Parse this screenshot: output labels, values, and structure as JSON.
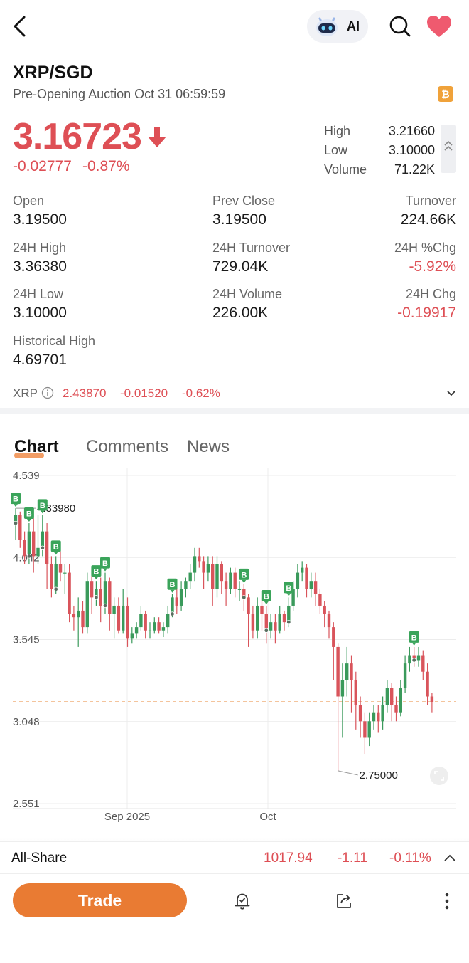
{
  "header": {
    "ai_label": "AI"
  },
  "instrument": {
    "symbol": "XRP/SGD",
    "session": "Pre-Opening Auction Oct 31 06:59:59",
    "coin_badge": "₿",
    "price": "3.16723",
    "change_abs": "-0.02777",
    "change_pct": "-0.87%",
    "direction": "down"
  },
  "summary": {
    "high_label": "High",
    "high_value": "3.21660",
    "low_label": "Low",
    "low_value": "3.10000",
    "volume_label": "Volume",
    "volume_value": "71.22K"
  },
  "stats": [
    {
      "label": "Open",
      "value": "3.19500",
      "neg": false
    },
    {
      "label": "Prev Close",
      "value": "3.19500",
      "neg": false
    },
    {
      "label": "Turnover",
      "value": "224.66K",
      "neg": false
    },
    {
      "label": "24H High",
      "value": "3.36380",
      "neg": false
    },
    {
      "label": "24H Turnover",
      "value": "729.04K",
      "neg": false
    },
    {
      "label": "24H %Chg",
      "value": "-5.92%",
      "neg": true
    },
    {
      "label": "24H Low",
      "value": "3.10000",
      "neg": false
    },
    {
      "label": "24H Volume",
      "value": "226.00K",
      "neg": false
    },
    {
      "label": "24H Chg",
      "value": "-0.19917",
      "neg": true
    },
    {
      "label": "Historical High",
      "value": "4.69701",
      "neg": false
    }
  ],
  "reference": {
    "name": "XRP",
    "price": "2.43870",
    "change": "-0.01520",
    "pct": "-0.62%"
  },
  "tabs": [
    {
      "label": "Chart",
      "active": true
    },
    {
      "label": "Comments",
      "active": false
    },
    {
      "label": "News",
      "active": false
    }
  ],
  "chart_data": {
    "type": "candlestick",
    "y_ticks": [
      "4.539",
      "4.042",
      "3.545",
      "3.048",
      "2.551"
    ],
    "ylim": [
      2.551,
      4.539
    ],
    "x_ticks": [
      "Sep 2025",
      "Oct"
    ],
    "max_label": "4.33980",
    "min_label": "2.75000",
    "last_price_line": 3.167,
    "colors": {
      "up": "#3a9a5b",
      "down": "#d9545b",
      "marker": "#3aa45a",
      "last_line": "#e8893a"
    },
    "candles": [
      [
        4.25,
        4.3,
        4.34,
        4.15
      ],
      [
        4.3,
        4.15,
        4.32,
        4.1
      ],
      [
        4.15,
        4.05,
        4.2,
        4.0
      ],
      [
        4.05,
        4.2,
        4.25,
        4.0
      ],
      [
        4.2,
        4.05,
        4.28,
        3.95
      ],
      [
        4.05,
        4.1,
        4.3,
        4.0
      ],
      [
        4.1,
        4.2,
        4.3,
        4.05
      ],
      [
        4.2,
        4.0,
        4.25,
        3.85
      ],
      [
        4.0,
        3.85,
        4.05,
        3.8
      ],
      [
        3.85,
        4.0,
        4.05,
        3.82
      ],
      [
        4.0,
        3.95,
        4.08,
        3.9
      ],
      [
        3.95,
        3.95,
        4.0,
        3.82
      ],
      [
        3.95,
        3.7,
        4.0,
        3.65
      ],
      [
        3.7,
        3.68,
        3.75,
        3.6
      ],
      [
        3.68,
        3.72,
        3.8,
        3.5
      ],
      [
        3.72,
        3.62,
        3.78,
        3.58
      ],
      [
        3.62,
        3.9,
        3.95,
        3.58
      ],
      [
        3.9,
        3.8,
        3.95,
        3.7
      ],
      [
        3.8,
        3.85,
        3.9,
        3.75
      ],
      [
        3.85,
        3.75,
        3.92,
        3.65
      ],
      [
        3.75,
        3.9,
        3.95,
        3.7
      ],
      [
        3.9,
        3.7,
        3.92,
        3.6
      ],
      [
        3.7,
        3.75,
        3.8,
        3.55
      ],
      [
        3.75,
        3.6,
        3.8,
        3.58
      ],
      [
        3.6,
        3.75,
        3.85,
        3.58
      ],
      [
        3.75,
        3.55,
        3.8,
        3.5
      ],
      [
        3.55,
        3.58,
        3.62,
        3.52
      ],
      [
        3.58,
        3.62,
        3.65,
        3.55
      ],
      [
        3.62,
        3.7,
        3.75,
        3.6
      ],
      [
        3.7,
        3.6,
        3.72,
        3.55
      ],
      [
        3.6,
        3.6,
        3.65,
        3.55
      ],
      [
        3.6,
        3.65,
        3.68,
        3.58
      ],
      [
        3.65,
        3.6,
        3.68,
        3.58
      ],
      [
        3.6,
        3.62,
        3.65,
        3.56
      ],
      [
        3.62,
        3.7,
        3.75,
        3.58
      ],
      [
        3.7,
        3.8,
        3.82,
        3.68
      ],
      [
        3.8,
        3.75,
        3.85,
        3.7
      ],
      [
        3.75,
        3.85,
        3.9,
        3.72
      ],
      [
        3.85,
        3.9,
        3.92,
        3.8
      ],
      [
        3.9,
        3.95,
        4.0,
        3.85
      ],
      [
        3.95,
        4.05,
        4.1,
        3.9
      ],
      [
        4.05,
        4.02,
        4.1,
        3.98
      ],
      [
        4.02,
        3.95,
        4.05,
        3.85
      ],
      [
        3.95,
        4.0,
        4.05,
        3.9
      ],
      [
        4.0,
        3.85,
        4.05,
        3.75
      ],
      [
        3.85,
        4.0,
        4.05,
        3.8
      ],
      [
        4.0,
        3.9,
        4.02,
        3.82
      ],
      [
        3.9,
        3.85,
        3.95,
        3.75
      ],
      [
        3.85,
        3.95,
        3.98,
        3.82
      ],
      [
        3.95,
        3.85,
        3.98,
        3.8
      ],
      [
        3.85,
        3.85,
        3.9,
        3.78
      ],
      [
        3.85,
        3.8,
        3.88,
        3.72
      ],
      [
        3.8,
        3.7,
        3.82,
        3.5
      ],
      [
        3.7,
        3.6,
        3.75,
        3.55
      ],
      [
        3.6,
        3.75,
        3.8,
        3.55
      ],
      [
        3.75,
        3.7,
        3.8,
        3.6
      ],
      [
        3.7,
        3.6,
        3.75,
        3.52
      ],
      [
        3.6,
        3.65,
        3.7,
        3.55
      ],
      [
        3.65,
        3.6,
        3.7,
        3.52
      ],
      [
        3.6,
        3.7,
        3.75,
        3.58
      ],
      [
        3.7,
        3.65,
        3.72,
        3.6
      ],
      [
        3.65,
        3.75,
        3.8,
        3.62
      ],
      [
        3.75,
        3.85,
        3.9,
        3.72
      ],
      [
        3.85,
        3.95,
        4.0,
        3.8
      ],
      [
        3.95,
        3.98,
        4.02,
        3.9
      ],
      [
        3.98,
        3.85,
        4.0,
        3.8
      ],
      [
        3.85,
        3.9,
        3.95,
        3.8
      ],
      [
        3.9,
        3.82,
        3.95,
        3.75
      ],
      [
        3.82,
        3.75,
        3.85,
        3.7
      ],
      [
        3.75,
        3.7,
        3.78,
        3.62
      ],
      [
        3.7,
        3.62,
        3.72,
        3.55
      ],
      [
        3.62,
        3.5,
        3.65,
        3.3
      ],
      [
        3.5,
        3.2,
        3.52,
        2.75
      ],
      [
        3.2,
        3.3,
        3.4,
        2.95
      ],
      [
        3.3,
        3.4,
        3.5,
        3.2
      ],
      [
        3.4,
        3.3,
        3.45,
        3.1
      ],
      [
        3.3,
        3.15,
        3.35,
        3.0
      ],
      [
        3.15,
        3.05,
        3.2,
        2.95
      ],
      [
        3.05,
        2.95,
        3.1,
        2.85
      ],
      [
        2.95,
        3.05,
        3.1,
        2.9
      ],
      [
        3.05,
        3.1,
        3.15,
        3.0
      ],
      [
        3.1,
        3.05,
        3.15,
        2.98
      ],
      [
        3.05,
        3.15,
        3.2,
        3.0
      ],
      [
        3.15,
        3.25,
        3.3,
        3.1
      ],
      [
        3.25,
        3.15,
        3.28,
        3.05
      ],
      [
        3.15,
        3.1,
        3.2,
        3.05
      ],
      [
        3.1,
        3.25,
        3.3,
        3.08
      ],
      [
        3.25,
        3.4,
        3.45,
        3.22
      ],
      [
        3.4,
        3.45,
        3.5,
        3.35
      ],
      [
        3.45,
        3.42,
        3.5,
        3.38
      ],
      [
        3.42,
        3.45,
        3.5,
        3.38
      ],
      [
        3.45,
        3.35,
        3.48,
        3.3
      ],
      [
        3.35,
        3.2,
        3.4,
        3.15
      ],
      [
        3.2,
        3.167,
        3.22,
        3.1
      ]
    ],
    "buy_markers": [
      0,
      3,
      6,
      9,
      18,
      20,
      35,
      51,
      56,
      61,
      89
    ]
  },
  "index_ticker": {
    "name": "All-Share",
    "value": "1017.94",
    "change": "-1.11",
    "pct": "-0.11%"
  },
  "actions": {
    "trade_label": "Trade"
  }
}
